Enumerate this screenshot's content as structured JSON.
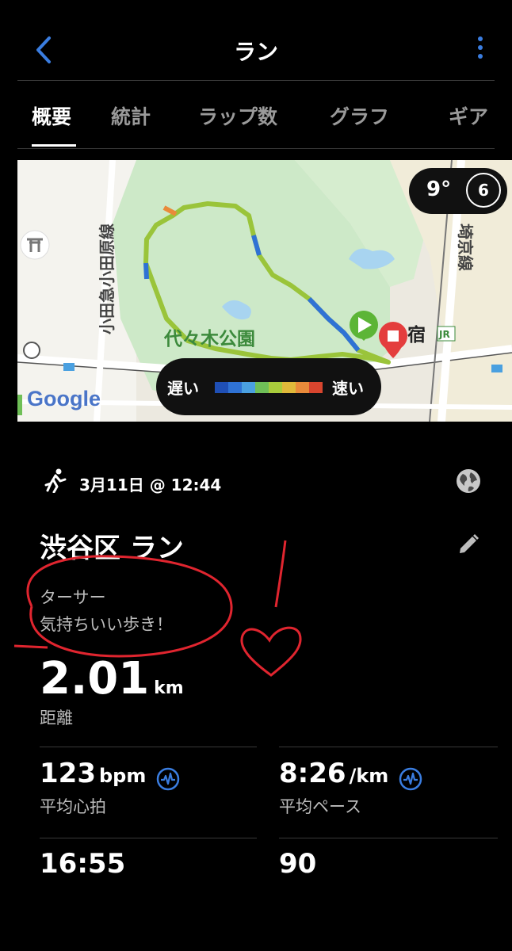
{
  "header": {
    "title": "ラン"
  },
  "tabs": [
    {
      "label": "概要"
    },
    {
      "label": "統計"
    },
    {
      "label": "ラップ数"
    },
    {
      "label": "グラフ"
    },
    {
      "label": "ギア"
    }
  ],
  "map": {
    "labels": {
      "park": "代々木公園",
      "line_odakyu": "小田急小田原線",
      "line_saikyo": "埼京線",
      "station": "宿",
      "jr": "JR"
    },
    "attribution": "Google",
    "legend": {
      "slow": "遅い",
      "fast": "速い",
      "colors": [
        "#1f4fb5",
        "#2f72d4",
        "#4aa0e0",
        "#6fbf57",
        "#a9cc3c",
        "#e0b93a",
        "#e98a3a",
        "#d8452e"
      ]
    },
    "weather": {
      "temp": "9°",
      "wind": "6"
    }
  },
  "activity": {
    "datetime": "3月11日 @ 12:44",
    "title": "渋谷区 ラン",
    "notes": [
      "ターサー",
      "気持ちいい歩き！"
    ]
  },
  "distance": {
    "value": "2.01",
    "unit": "km",
    "label": "距離"
  },
  "stats": {
    "heart_rate": {
      "value": "123",
      "unit": "bpm",
      "label": "平均心拍"
    },
    "pace": {
      "value": "8:26",
      "unit": "/km",
      "label": "平均ペース"
    },
    "time": {
      "value": "16:55"
    },
    "cadence": {
      "value": "90"
    }
  },
  "colors": {
    "accent": "#3a7de0",
    "annotation": "#e0252f"
  }
}
